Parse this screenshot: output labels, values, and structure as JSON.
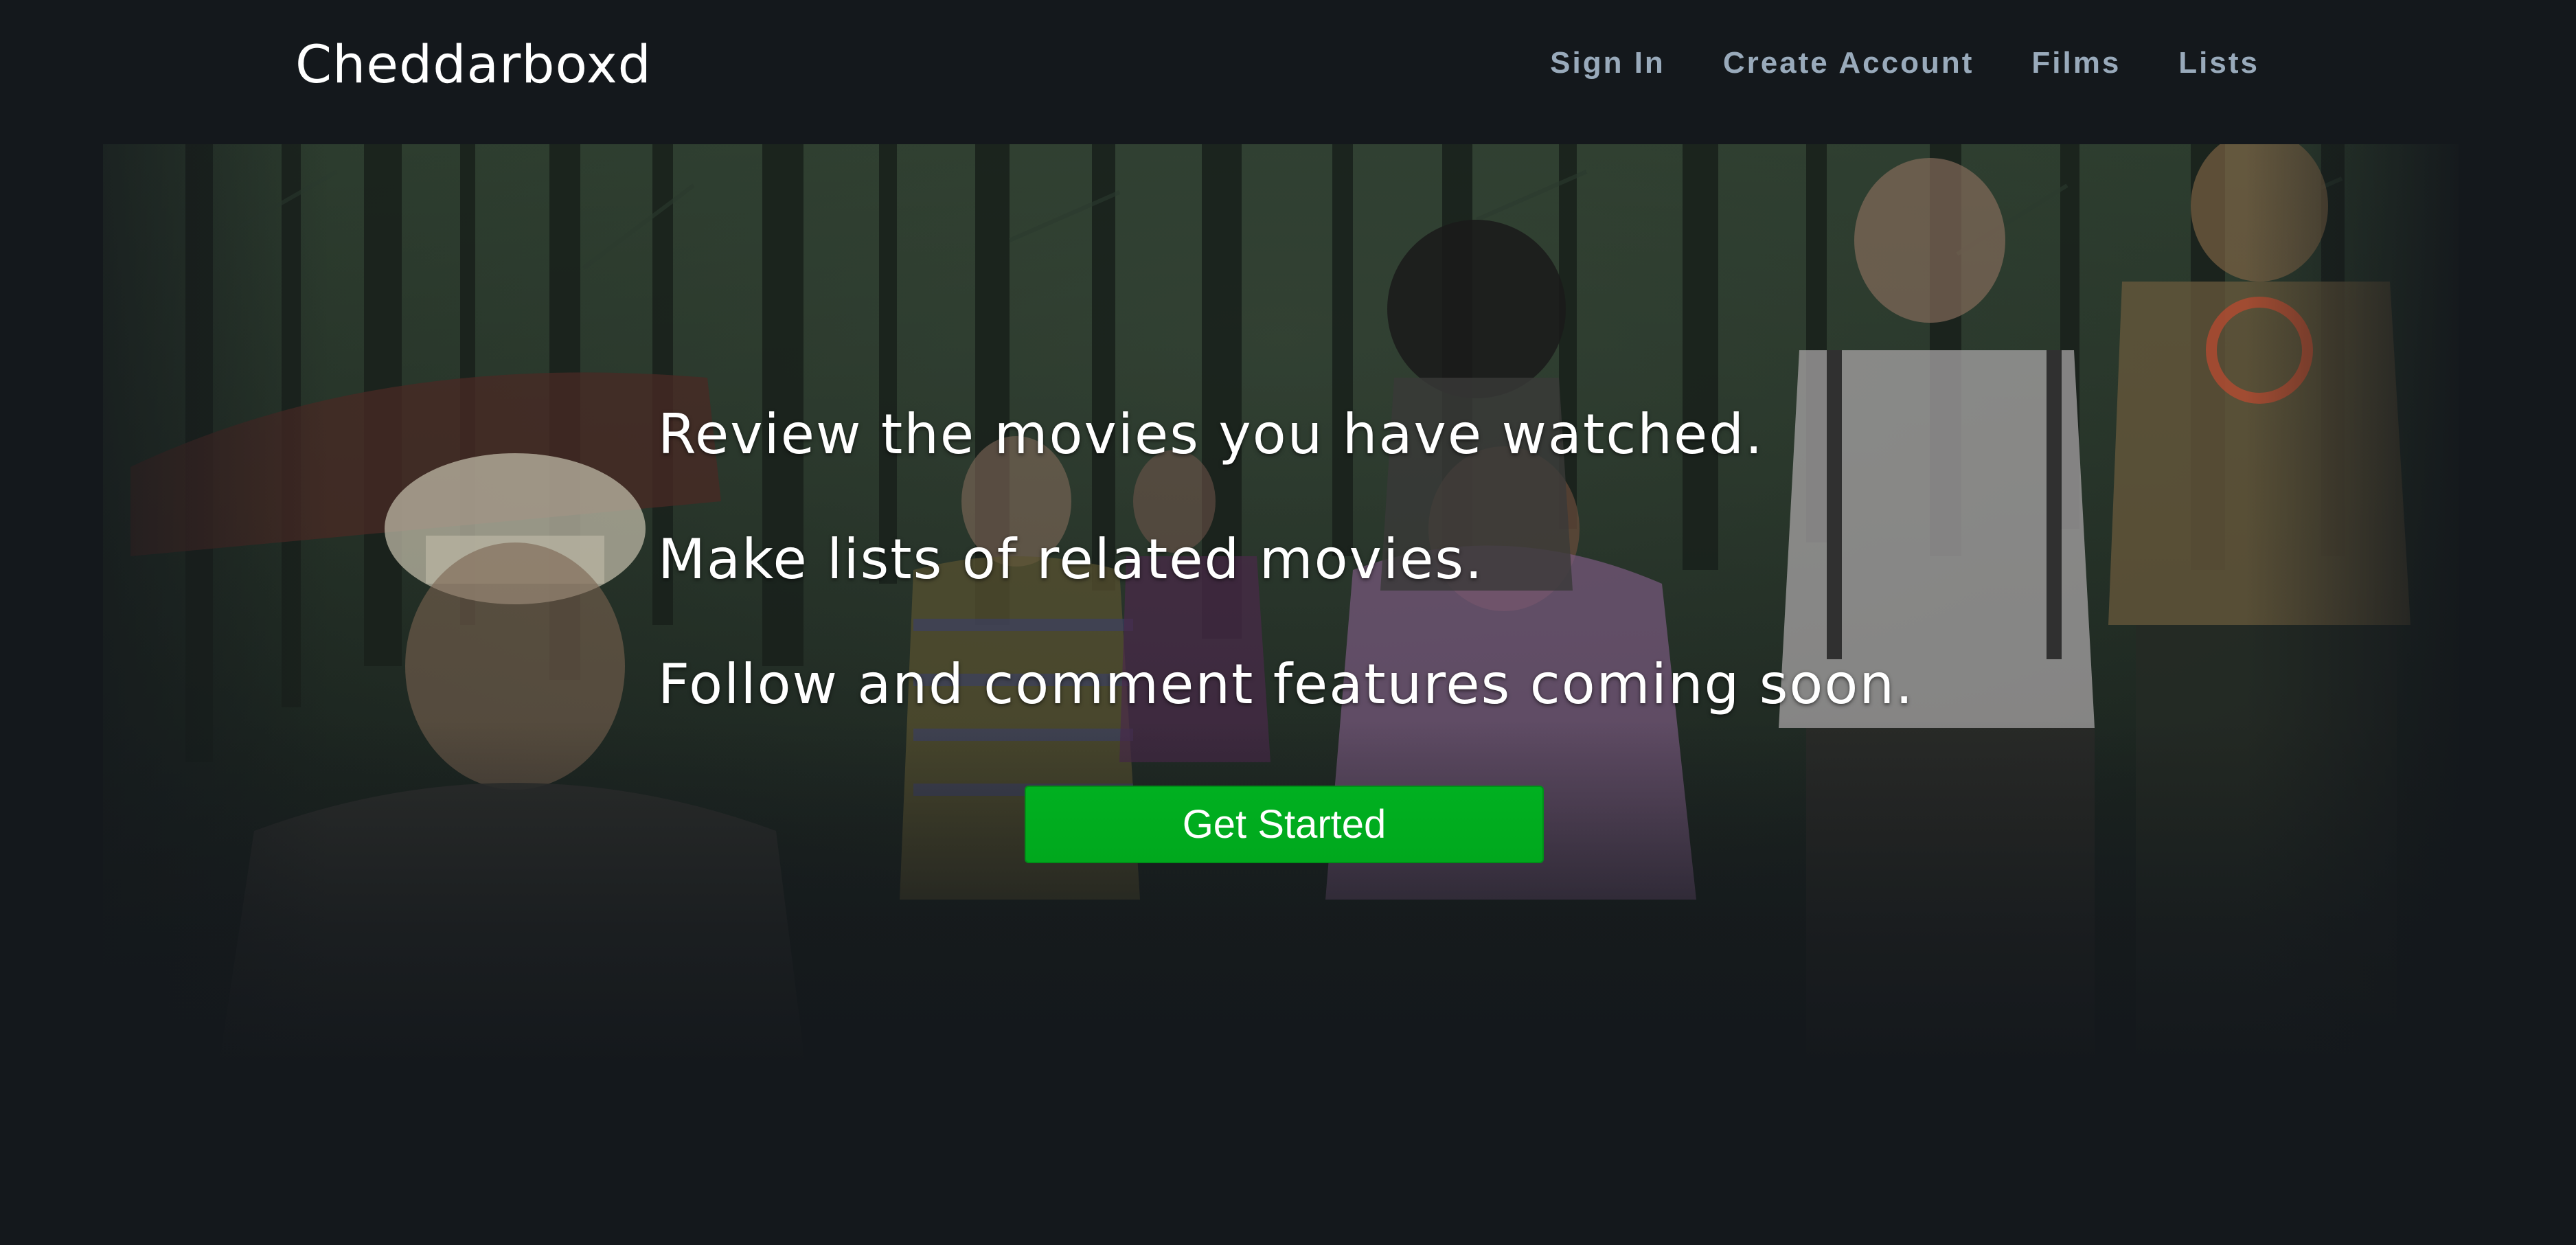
{
  "header": {
    "brand": "Cheddarboxd",
    "nav": [
      {
        "label": "Sign In"
      },
      {
        "label": "Create Account"
      },
      {
        "label": "Films"
      },
      {
        "label": "Lists"
      }
    ]
  },
  "hero": {
    "lines": [
      "Review the movies you have watched.",
      "Make lists of related movies.",
      "Follow and comment features coming soon."
    ],
    "cta_label": "Get Started"
  },
  "colors": {
    "background": "#14181c",
    "nav_text": "#99aabb",
    "cta": "#00ac1c",
    "text": "#ffffff"
  }
}
